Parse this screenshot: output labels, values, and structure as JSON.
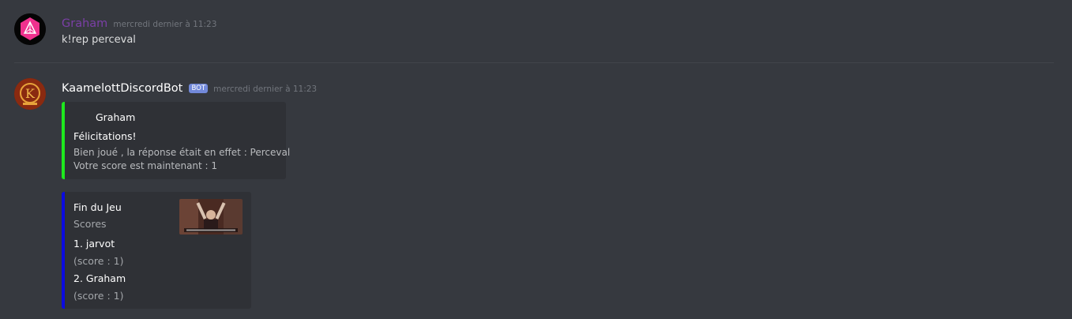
{
  "colors": {
    "background": "#36393f",
    "embed_bg": "#2f3136",
    "success_bar": "#1ee81e",
    "scores_bar": "#0b0bdf",
    "graham_name": "#7b3fa6",
    "bot_tag": "#7289da"
  },
  "messages": [
    {
      "username": "Graham",
      "timestamp": "mercredi dernier à 11:23",
      "avatar_icon": "pink-polyhedron-avatar-icon",
      "text": "k!rep perceval"
    },
    {
      "username": "KaamelottDiscordBot",
      "bot_tag": "BOT",
      "timestamp": "mercredi dernier à 11:23",
      "avatar_icon": "kaamelott-logo-avatar-icon"
    }
  ],
  "embeds": [
    {
      "author": "Graham",
      "title": "Félicitations!",
      "description_line1": "Bien joué , la réponse était en effet : Perceval",
      "description_line2": "Votre score est maintenant : 1"
    },
    {
      "title": "Fin du Jeu",
      "subtitle": "Scores",
      "entries": [
        {
          "name": "1. jarvot",
          "value": "(score : 1)"
        },
        {
          "name": "2. Graham",
          "value": "(score : 1)"
        }
      ],
      "thumbnail_icon": "perceval-gif-thumbnail-icon"
    }
  ]
}
